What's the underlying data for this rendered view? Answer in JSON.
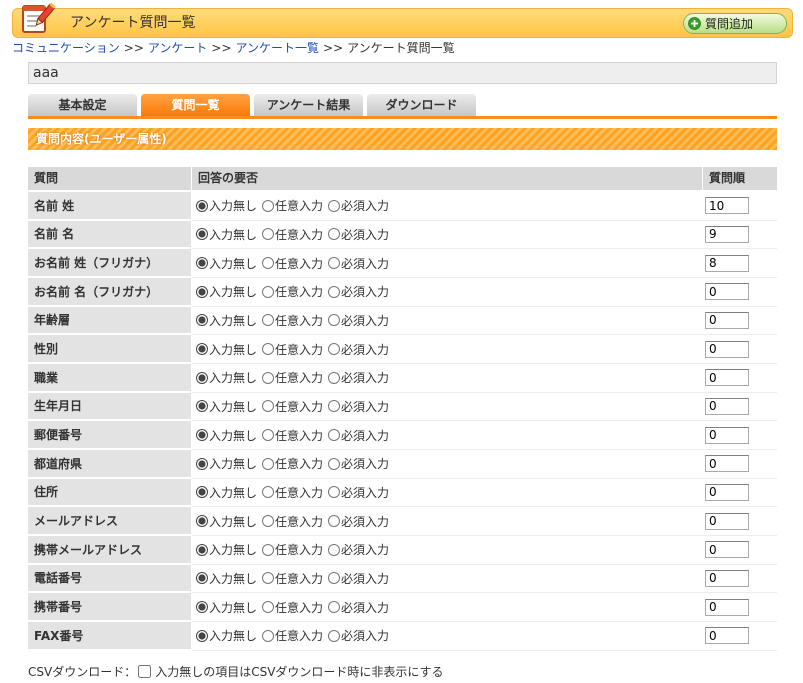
{
  "header": {
    "icon": "notepad-pencil-icon",
    "title": "アンケート質問一覧",
    "add_button": {
      "icon": "plus-circle-icon",
      "label": "質問追加"
    }
  },
  "breadcrumb": {
    "separator": ">>",
    "items": [
      {
        "label": "コミュニケーション",
        "is_link": true
      },
      {
        "label": "アンケート",
        "is_link": true
      },
      {
        "label": "アンケート一覧",
        "is_link": true
      },
      {
        "label": "アンケート質問一覧",
        "is_link": false
      }
    ]
  },
  "survey_name": "aaa",
  "tabs": [
    {
      "label": "基本設定",
      "active": false
    },
    {
      "label": "質問一覧",
      "active": true
    },
    {
      "label": "アンケート結果",
      "active": false
    },
    {
      "label": "ダウンロード",
      "active": false
    }
  ],
  "section_title": "質問内容(ユーザー属性)",
  "table": {
    "headers": {
      "question": "質問",
      "requirement": "回答の要否",
      "order": "質問順"
    },
    "options": [
      "入力無し",
      "任意入力",
      "必須入力"
    ],
    "rows": [
      {
        "question": "名前 姓",
        "selected_option": 0,
        "order": "10"
      },
      {
        "question": "名前 名",
        "selected_option": 0,
        "order": "9"
      },
      {
        "question": "お名前 姓（フリガナ）",
        "selected_option": 0,
        "order": "8"
      },
      {
        "question": "お名前 名（フリガナ）",
        "selected_option": 0,
        "order": "0"
      },
      {
        "question": "年齢層",
        "selected_option": 0,
        "order": "0"
      },
      {
        "question": "性別",
        "selected_option": 0,
        "order": "0"
      },
      {
        "question": "職業",
        "selected_option": 0,
        "order": "0"
      },
      {
        "question": "生年月日",
        "selected_option": 0,
        "order": "0"
      },
      {
        "question": "郵便番号",
        "selected_option": 0,
        "order": "0"
      },
      {
        "question": "都道府県",
        "selected_option": 0,
        "order": "0"
      },
      {
        "question": "住所",
        "selected_option": 0,
        "order": "0"
      },
      {
        "question": "メールアドレス",
        "selected_option": 0,
        "order": "0"
      },
      {
        "question": "携帯メールアドレス",
        "selected_option": 0,
        "order": "0"
      },
      {
        "question": "電話番号",
        "selected_option": 0,
        "order": "0"
      },
      {
        "question": "携帯番号",
        "selected_option": 0,
        "order": "0"
      },
      {
        "question": "FAX番号",
        "selected_option": 0,
        "order": "0"
      }
    ]
  },
  "csv": {
    "label": "CSVダウンロード：",
    "checkbox_label": "入力無しの項目はCSVダウンロード時に非表示にする",
    "checked": false
  },
  "colors": {
    "header_bar": "#ffcf5c",
    "accent_orange": "#ff8a1e",
    "link_blue": "#1f4fb4",
    "add_button_green": "#3b9e2a",
    "table_header_gray": "#d9d9d9",
    "question_cell_gray": "#e3e3e3"
  }
}
